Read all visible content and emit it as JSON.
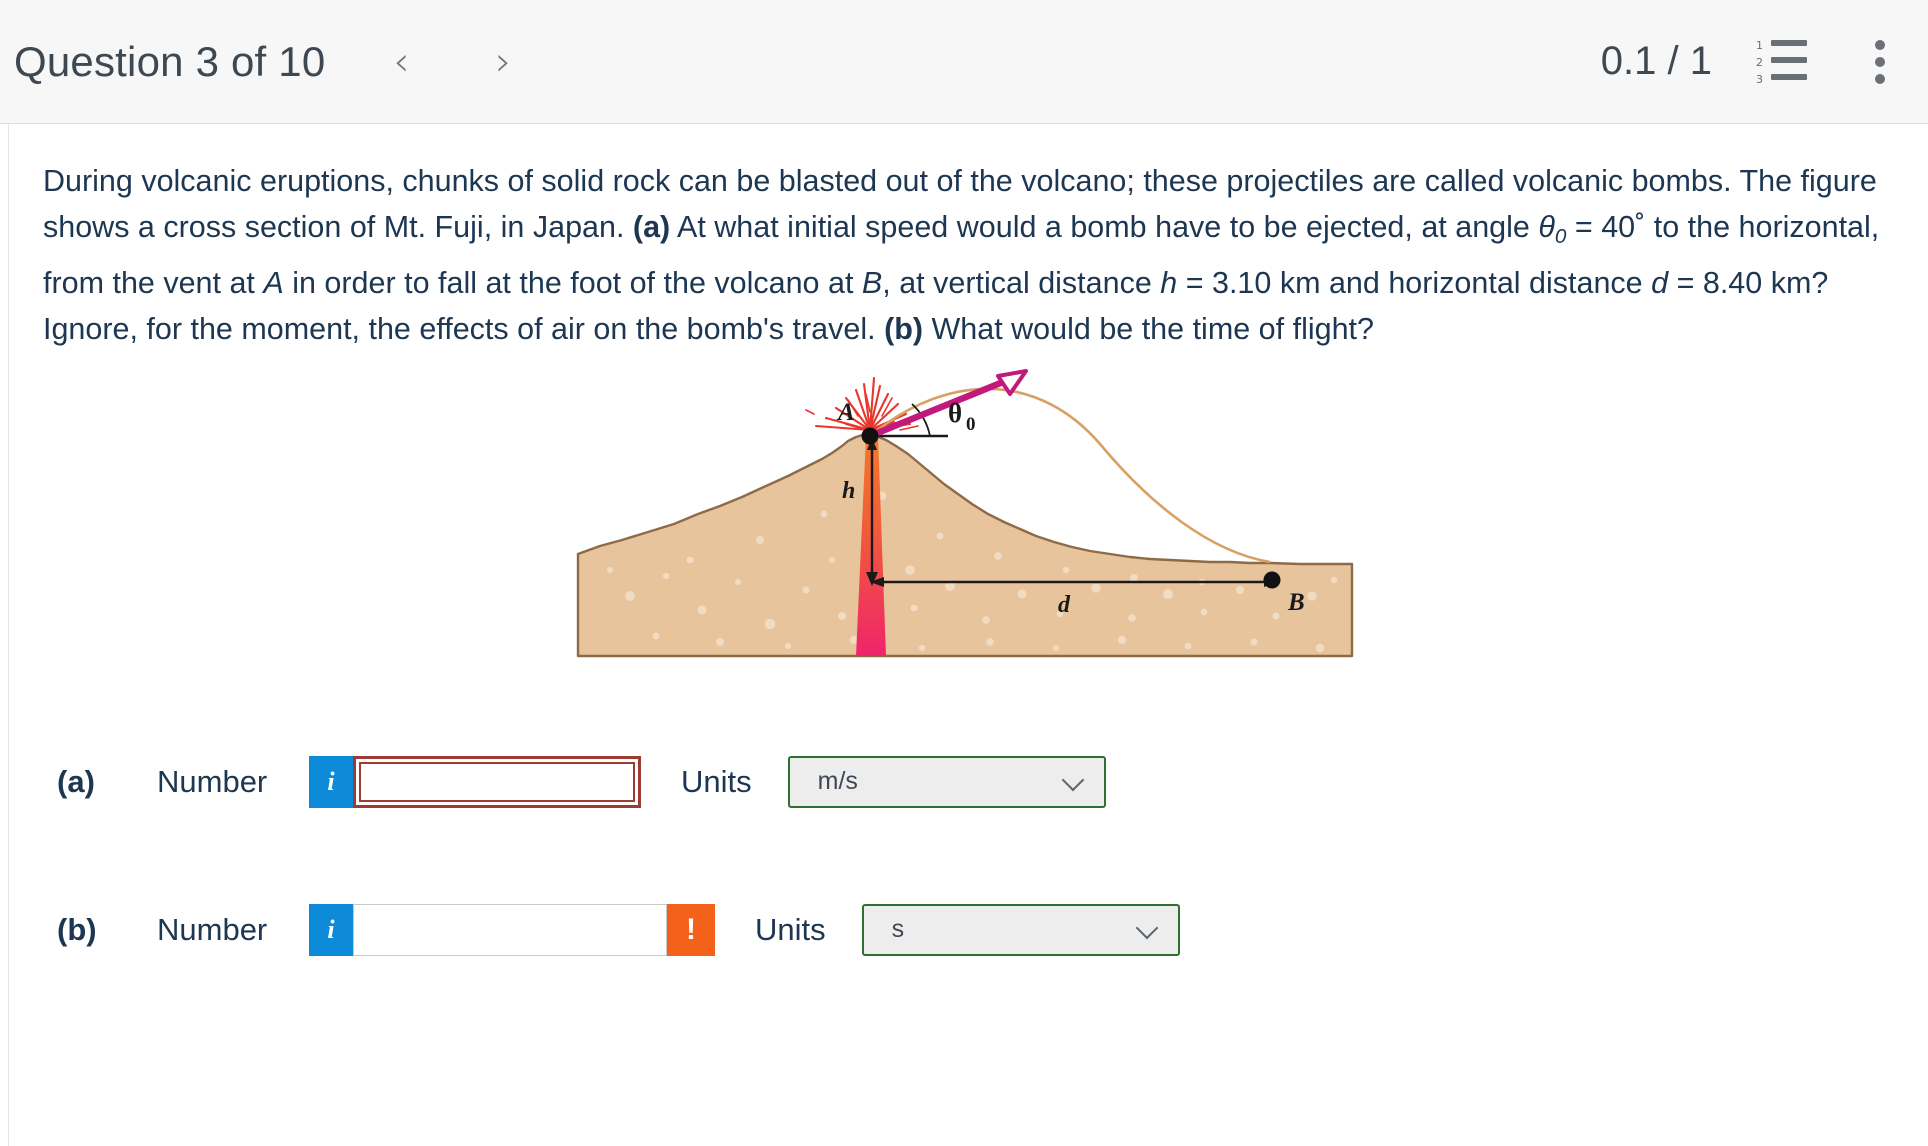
{
  "header": {
    "question_title": "Question 3 of 10",
    "prev_arrow": "‹",
    "next_arrow": "›",
    "score": "0.1 / 1",
    "list_icon_numbers": [
      "1",
      "2",
      "3"
    ],
    "list_icon_name": "numbered-list-icon",
    "kebab_icon_name": "more-options-icon"
  },
  "question": {
    "line1_a": "During volcanic eruptions, chunks of solid rock can be blasted out of the volcano; these projectiles are called volcanic bombs. The figure shows a cross section of Mt. Fuji, in Japan. ",
    "part_a_tag": "(a)",
    "line1_b": " At what initial speed would a bomb have to be ejected, at angle ",
    "theta": "θ",
    "theta_sub": "0",
    "angle_eq": " = 40˚ to the horizontal, from the vent at ",
    "point_a": "A",
    "line2": " in order to fall at the foot of the volcano at ",
    "point_b": "B",
    "line3": ", at vertical distance ",
    "var_h": "h",
    "h_val": " = 3.10 km and horizontal distance ",
    "var_d": "d",
    "d_val": " = 8.40 km? Ignore, for the moment, the effects of air on the bomb's travel. ",
    "part_b_tag": "(b)",
    "line4": " What would be the time of flight?"
  },
  "figure": {
    "label_a": "A",
    "label_b": "B",
    "label_h": "h",
    "label_d": "d",
    "label_theta": "θ",
    "label_theta_sub": "0",
    "colors": {
      "ground": "#e8c39a",
      "ground_edge": "#8a6a4a",
      "magma_top": "#f47b20",
      "magma_bottom": "#ee2a6e",
      "velocity_arrow": "#c2197c",
      "trajectory": "#d9a062",
      "spray": "#e8362c"
    }
  },
  "answers": [
    {
      "part": "(a)",
      "number_label": "Number",
      "info_icon": "i",
      "value": "",
      "input_state": "error",
      "units_label": "Units",
      "units_value": "m/s",
      "chevron_icon": "chevron-down-icon"
    },
    {
      "part": "(b)",
      "number_label": "Number",
      "info_icon": "i",
      "value": "",
      "warn_icon": "!",
      "input_state": "warning",
      "units_label": "Units",
      "units_value": "s",
      "chevron_icon": "chevron-down-icon"
    }
  ]
}
